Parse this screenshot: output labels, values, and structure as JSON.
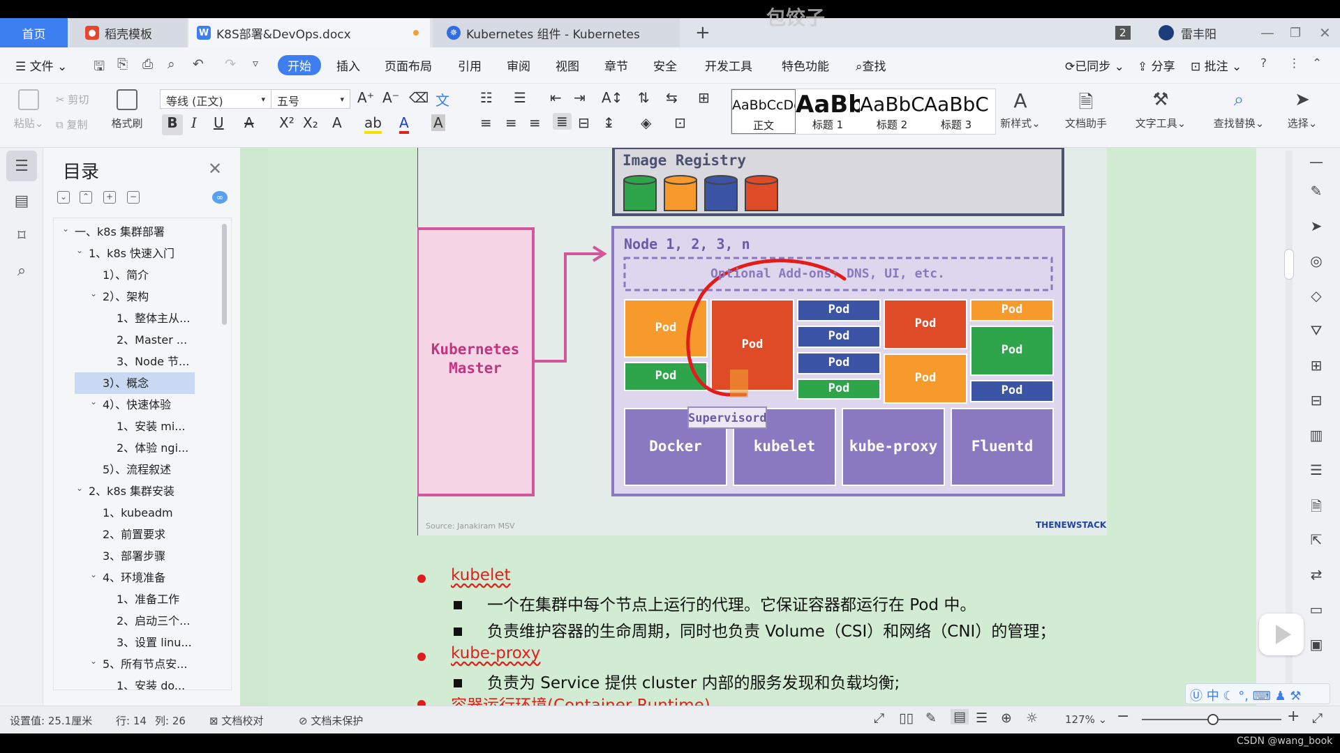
{
  "watermark": "包饺子",
  "tabs": {
    "home": "首页",
    "template": "稻壳模板",
    "doc": "K8S部署&DevOps.docx",
    "browser": "Kubernetes 组件 - Kubernetes",
    "window_count": "2",
    "user": "雷丰阳"
  },
  "menu": {
    "file": "文件",
    "start": "开始",
    "insert": "插入",
    "layout": "页面布局",
    "reference": "引用",
    "review": "审阅",
    "view": "视图",
    "chapter": "章节",
    "security": "安全",
    "devtools": "开发工具",
    "special": "特色功能",
    "search": "查找",
    "synced": "已同步",
    "share": "分享",
    "comment": "批注"
  },
  "ribbon": {
    "paste": "粘贴",
    "cut": "剪切",
    "copy": "复制",
    "format_painter": "格式刷",
    "font_family": "等线 (正文)",
    "font_size": "五号",
    "styles": [
      {
        "sample": "AaBbCcDd",
        "name": "正文"
      },
      {
        "sample": "AaBb",
        "name": "标题 1"
      },
      {
        "sample": "AaBbC",
        "name": "标题 2"
      },
      {
        "sample": "AaBbC",
        "name": "标题 3"
      }
    ],
    "new_style": "新样式",
    "doc_assistant": "文档助手",
    "text_tools": "文字工具",
    "find_replace": "查找替换",
    "select": "选择"
  },
  "toc": {
    "title": "目录",
    "items": [
      {
        "level": 0,
        "label": "一、k8s 集群部署",
        "expanded": true
      },
      {
        "level": 1,
        "label": "1、k8s 快速入门",
        "expanded": true
      },
      {
        "level": 2,
        "label": "1）、简介"
      },
      {
        "level": 2,
        "label": "2）、架构",
        "expanded": true
      },
      {
        "level": 3,
        "label": "1、整体主从..."
      },
      {
        "level": 3,
        "label": "2、Master ..."
      },
      {
        "level": 3,
        "label": "3、Node 节..."
      },
      {
        "level": 2,
        "label": "3）、概念",
        "selected": true
      },
      {
        "level": 2,
        "label": "4）、快速体验",
        "expanded": true
      },
      {
        "level": 3,
        "label": "1、安装 mi..."
      },
      {
        "level": 3,
        "label": "2、体验 ngi..."
      },
      {
        "level": 2,
        "label": "5）、流程叙述"
      },
      {
        "level": 1,
        "label": "2、k8s 集群安装",
        "expanded": true
      },
      {
        "level": 2,
        "label": "1、kubeadm"
      },
      {
        "level": 2,
        "label": "2、前置要求"
      },
      {
        "level": 2,
        "label": "3、部署步骤"
      },
      {
        "level": 2,
        "label": "4、环境准备",
        "expanded": true
      },
      {
        "level": 3,
        "label": "1、准备工作"
      },
      {
        "level": 3,
        "label": "2、启动三个..."
      },
      {
        "level": 3,
        "label": "3、设置 linu..."
      },
      {
        "level": 2,
        "label": "5、所有节点安...",
        "expanded": true
      },
      {
        "level": 3,
        "label": "1、安装 do..."
      }
    ]
  },
  "diagram": {
    "image_registry": "Image Registry",
    "master": "Kubernetes\nMaster",
    "node": "Node 1, 2, 3, n",
    "addons": "Optional Add-ons: DNS, UI, etc.",
    "pod": "Pod",
    "supervisord": "Supervisord",
    "components": [
      "Docker",
      "kubelet",
      "kube-proxy",
      "Fluentd"
    ],
    "source": "Source: Janakiram MSV",
    "brand": "THENEWSTACK",
    "colors": {
      "green": "#2ea54a",
      "orange": "#f79a2c",
      "blue": "#3c54a6",
      "red": "#e04b27",
      "purple": "#8a78c0",
      "pink": "#f6d6e6"
    }
  },
  "content": {
    "kubelet_title": "kubelet",
    "kubelet_1": "一个在集群中每个节点上运行的代理。它保证容器都运行在 Pod 中。",
    "kubelet_2": "负责维护容器的生命周期，同时也负责 Volume（CSI）和网络（CNI）的管理；",
    "kubeproxy_title": "kube-proxy",
    "kubeproxy_1": "负责为 Service 提供 cluster 内部的服务发现和负载均衡;",
    "next_title": "容器运行环境(Container Runtime)"
  },
  "status": {
    "setting": "设置值: 25.1厘米",
    "row": "行: 14",
    "col": "列: 26",
    "proof": "文档校对",
    "protect": "文档未保护",
    "zoom": "127%"
  },
  "footer": "CSDN @wang_book"
}
